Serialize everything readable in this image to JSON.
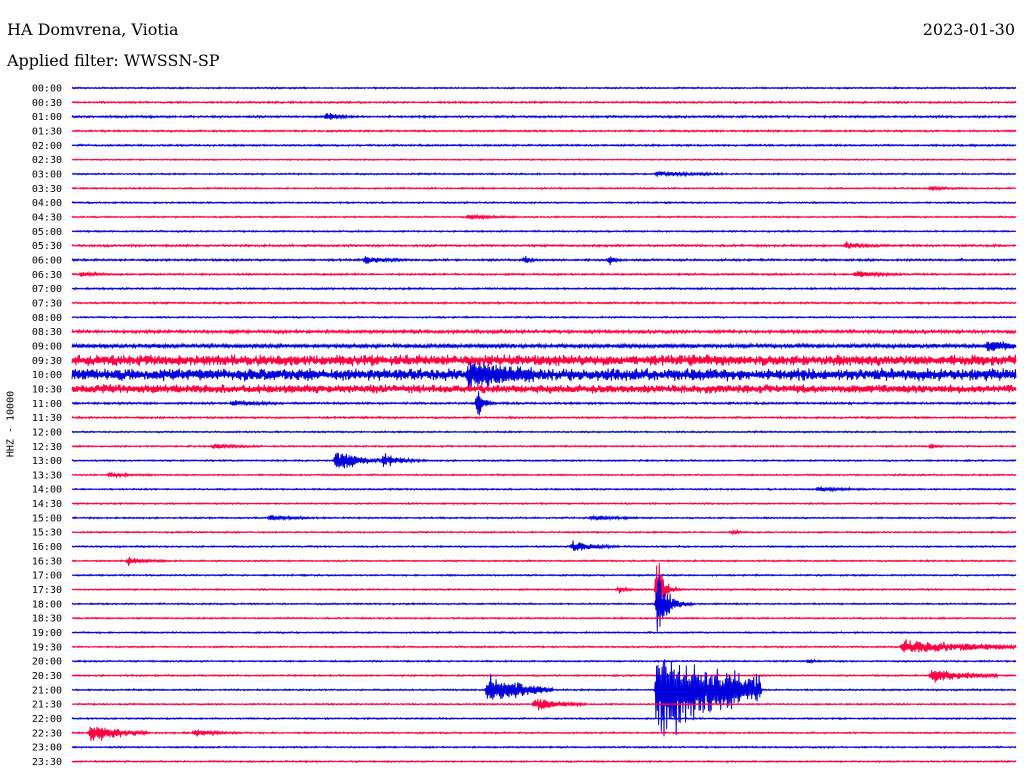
{
  "header": {
    "station": "HA Domvrena, Viotia",
    "date": "2023-01-30",
    "filter": "Applied filter: WWSSN-SP",
    "channel_label": "HHZ - 10000"
  },
  "colors": {
    "even_row": "#0000dd",
    "odd_row": "#ff0040"
  },
  "chart_data": {
    "type": "line",
    "title": "HA Domvrena, Viotia",
    "xlabel": "",
    "ylabel": "HHZ - 10000",
    "grid": false,
    "legend": "none",
    "rows": [
      "00:00",
      "00:30",
      "01:00",
      "01:30",
      "02:00",
      "02:30",
      "03:00",
      "03:30",
      "04:00",
      "04:30",
      "05:00",
      "05:30",
      "06:00",
      "06:30",
      "07:00",
      "07:30",
      "08:00",
      "08:30",
      "09:00",
      "09:30",
      "10:00",
      "10:30",
      "11:00",
      "11:30",
      "12:00",
      "12:30",
      "13:00",
      "13:30",
      "14:00",
      "14:30",
      "15:00",
      "15:30",
      "16:00",
      "16:30",
      "17:00",
      "17:30",
      "18:00",
      "18:30",
      "19:00",
      "19:30",
      "20:00",
      "20:30",
      "21:00",
      "21:30",
      "22:00",
      "22:30",
      "23:00",
      "23:30"
    ],
    "row_noise": [
      0.6,
      0.7,
      0.8,
      0.7,
      0.7,
      0.5,
      0.6,
      0.6,
      0.6,
      0.6,
      0.6,
      0.8,
      0.8,
      0.7,
      0.7,
      0.7,
      0.6,
      1.2,
      1.6,
      4.5,
      5.0,
      3.5,
      0.8,
      0.7,
      0.6,
      0.6,
      0.6,
      0.6,
      0.6,
      0.6,
      0.6,
      0.6,
      0.6,
      0.6,
      0.6,
      0.6,
      0.6,
      0.6,
      0.6,
      0.6,
      0.6,
      0.6,
      0.6,
      0.6,
      0.6,
      0.6,
      0.6,
      0.6
    ],
    "events": [
      {
        "row": 2,
        "x": 0.27,
        "amp": 5,
        "dur": 0.01
      },
      {
        "row": 6,
        "x": 0.62,
        "amp": 3,
        "dur": 0.04
      },
      {
        "row": 7,
        "x": 0.91,
        "amp": 3,
        "dur": 0.01
      },
      {
        "row": 9,
        "x": 0.42,
        "amp": 3,
        "dur": 0.02
      },
      {
        "row": 11,
        "x": 0.82,
        "amp": 4,
        "dur": 0.015
      },
      {
        "row": 12,
        "x": 0.31,
        "amp": 4,
        "dur": 0.02
      },
      {
        "row": 12,
        "x": 0.48,
        "amp": 5,
        "dur": 0.005
      },
      {
        "row": 12,
        "x": 0.57,
        "amp": 5,
        "dur": 0.005
      },
      {
        "row": 13,
        "x": 0.01,
        "amp": 4,
        "dur": 0.01
      },
      {
        "row": 13,
        "x": 0.83,
        "amp": 4,
        "dur": 0.02
      },
      {
        "row": 18,
        "x": 0.97,
        "amp": 6,
        "dur": 0.03
      },
      {
        "row": 20,
        "x": 0.42,
        "amp": 16,
        "dur": 0.04
      },
      {
        "row": 22,
        "x": 0.17,
        "amp": 4,
        "dur": 0.02
      },
      {
        "row": 22,
        "x": 0.43,
        "amp": 22,
        "dur": 0.005
      },
      {
        "row": 25,
        "x": 0.15,
        "amp": 3,
        "dur": 0.02
      },
      {
        "row": 25,
        "x": 0.91,
        "amp": 3,
        "dur": 0.005
      },
      {
        "row": 26,
        "x": 0.28,
        "amp": 16,
        "dur": 0.02
      },
      {
        "row": 26,
        "x": 0.33,
        "amp": 9,
        "dur": 0.015
      },
      {
        "row": 27,
        "x": 0.04,
        "amp": 3,
        "dur": 0.015
      },
      {
        "row": 28,
        "x": 0.79,
        "amp": 3,
        "dur": 0.02
      },
      {
        "row": 30,
        "x": 0.21,
        "amp": 3,
        "dur": 0.02
      },
      {
        "row": 30,
        "x": 0.55,
        "amp": 3,
        "dur": 0.02
      },
      {
        "row": 31,
        "x": 0.7,
        "amp": 3,
        "dur": 0.005
      },
      {
        "row": 32,
        "x": 0.53,
        "amp": 7,
        "dur": 0.02
      },
      {
        "row": 33,
        "x": 0.06,
        "amp": 5,
        "dur": 0.015
      },
      {
        "row": 35,
        "x": 0.58,
        "amp": 5,
        "dur": 0.005
      },
      {
        "row": 35,
        "x": 0.62,
        "amp": 60,
        "dur": 0.005
      },
      {
        "row": 36,
        "x": 0.62,
        "amp": 40,
        "dur": 0.01
      },
      {
        "row": 39,
        "x": 0.88,
        "amp": 8,
        "dur": 0.09
      },
      {
        "row": 40,
        "x": 0.78,
        "amp": 3,
        "dur": 0.005
      },
      {
        "row": 41,
        "x": 0.91,
        "amp": 8,
        "dur": 0.04
      },
      {
        "row": 42,
        "x": 0.44,
        "amp": 18,
        "dur": 0.04
      },
      {
        "row": 42,
        "x": 0.62,
        "amp": 60,
        "dur": 0.08
      },
      {
        "row": 43,
        "x": 0.49,
        "amp": 8,
        "dur": 0.025
      },
      {
        "row": 45,
        "x": 0.02,
        "amp": 12,
        "dur": 0.03
      },
      {
        "row": 45,
        "x": 0.13,
        "amp": 4,
        "dur": 0.02
      }
    ]
  }
}
